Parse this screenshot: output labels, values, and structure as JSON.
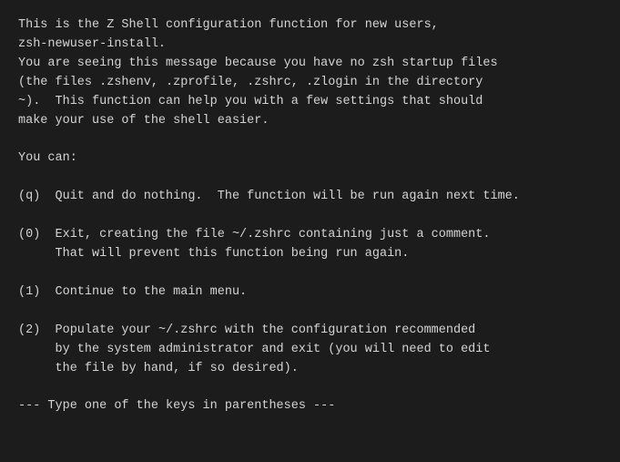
{
  "terminal": {
    "lines": [
      "This is the Z Shell configuration function for new users,",
      "zsh-newuser-install.",
      "You are seeing this message because you have no zsh startup files",
      "(the files .zshenv, .zprofile, .zshrc, .zlogin in the directory",
      "~).  This function can help you with a few settings that should",
      "make your use of the shell easier.",
      "",
      "You can:",
      "",
      "(q)  Quit and do nothing.  The function will be run again next time.",
      "",
      "(0)  Exit, creating the file ~/.zshrc containing just a comment.",
      "     That will prevent this function being run again.",
      "",
      "(1)  Continue to the main menu.",
      "",
      "(2)  Populate your ~/.zshrc with the configuration recommended",
      "     by the system administrator and exit (you will need to edit",
      "     the file by hand, if so desired).",
      "",
      "--- Type one of the keys in parentheses ---"
    ]
  }
}
